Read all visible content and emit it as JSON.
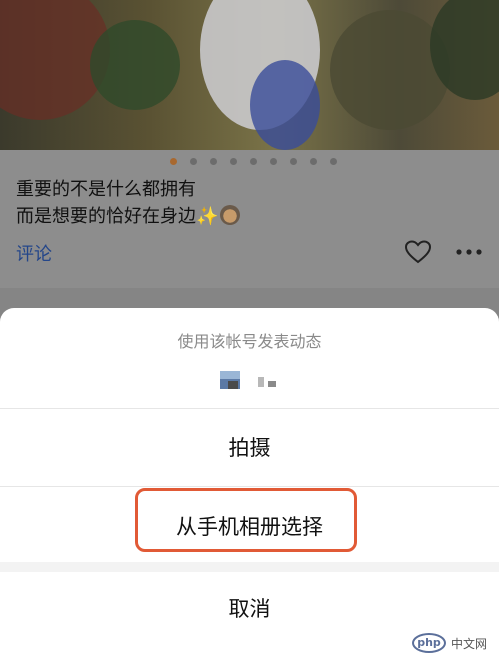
{
  "post": {
    "caption_line1": "重要的不是什么都拥有",
    "caption_line2": "而是想要的恰好在身边",
    "caption_emoji_sparkle": "✨",
    "caption_emoji_face": "face-icon",
    "comment_label": "评论",
    "carousel": {
      "total": 9,
      "active_index": 0
    },
    "icons": [
      "heart-icon",
      "more-icon"
    ]
  },
  "sheet": {
    "title": "使用该帐号发表动态",
    "options": [
      {
        "label": "拍摄"
      },
      {
        "label": "从手机相册选择"
      },
      {
        "label": "取消"
      }
    ]
  },
  "watermark": {
    "logo": "php",
    "text": "中文网"
  },
  "colors": {
    "link": "#24468a",
    "highlight": "#e15a36",
    "dot_active": "#a8682f"
  }
}
